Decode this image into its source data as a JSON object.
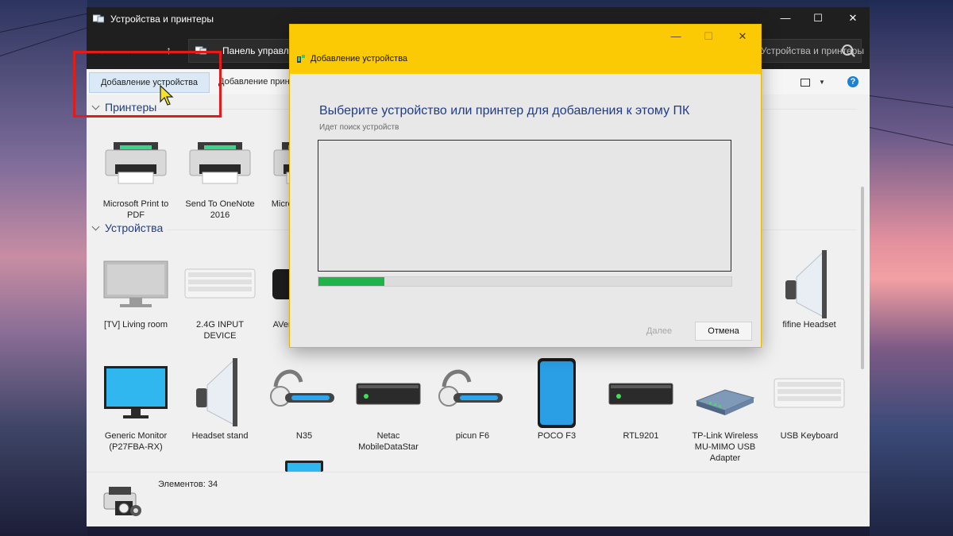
{
  "window": {
    "title": "Устройства и принтеры",
    "address": "Панель управле",
    "search_placeholder": "Устройства и принтеры",
    "back_icon": "←",
    "forward_icon": "→",
    "up_icon": "↑",
    "minimize": "—",
    "maximize": "☐",
    "close": "✕"
  },
  "toolbar": {
    "add_device": "Добавление устройства",
    "add_printer": "Добавление принтера",
    "view_caret": "▼",
    "help": "?"
  },
  "groups": {
    "printers": "Принтеры",
    "devices": "Устройства"
  },
  "printers": [
    {
      "label": "Microsoft Print to PDF",
      "icon": "printer-icon"
    },
    {
      "label": "Send To OneNote 2016",
      "icon": "printer-icon"
    },
    {
      "label": "Microsoft Print to PDF",
      "icon": "printer-icon"
    }
  ],
  "devices": [
    {
      "label": "[TV] Living room",
      "icon": "tv-icon"
    },
    {
      "label": "2.4G INPUT DEVICE",
      "icon": "keyboard-icon"
    },
    {
      "label": "AVerMedia USB",
      "icon": "capture-device-icon"
    },
    {
      "label": "fifine Headset",
      "icon": "speaker-icon"
    },
    {
      "label": "Generic Monitor (P27FBA-RX)",
      "icon": "monitor-icon"
    },
    {
      "label": "Headset stand",
      "icon": "speaker-icon"
    },
    {
      "label": "N35",
      "icon": "headset-icon"
    },
    {
      "label": "Netac MobileDataStar",
      "icon": "drive-icon"
    },
    {
      "label": "picun F6",
      "icon": "headset-icon"
    },
    {
      "label": "POCO F3",
      "icon": "phone-icon"
    },
    {
      "label": "RTL9201",
      "icon": "drive-icon"
    },
    {
      "label": "TP-Link Wireless MU-MIMO USB Adapter",
      "icon": "network-adapter-icon"
    },
    {
      "label": "USB Keyboard",
      "icon": "keyboard-icon"
    }
  ],
  "status": {
    "count": "Элементов: 34"
  },
  "dialog": {
    "title": "Добавление устройства",
    "heading": "Выберите устройство или принтер для добавления к этому ПК",
    "subtext": "Идет поиск устройств",
    "progress_percent": 16,
    "next": "Далее",
    "cancel": "Отмена",
    "minimize": "—",
    "maximize": "☐",
    "close": "✕"
  },
  "colors": {
    "dialog_title_bg": "#fcca04",
    "heading": "#1e3c8a",
    "progress": "#1fb34a",
    "highlight": "#e21b1b"
  }
}
